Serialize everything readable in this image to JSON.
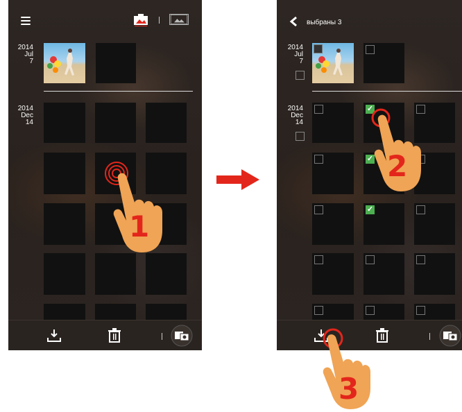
{
  "left_screen": {
    "dates": [
      {
        "year": "2014",
        "month": "Jul",
        "day": "7"
      },
      {
        "year": "2014",
        "month": "Dec",
        "day": "14"
      }
    ],
    "icons": {
      "menu": "menu-icon",
      "camera_tab": "camera-tab-icon",
      "gallery_tab": "gallery-tab-icon",
      "download": "download-icon",
      "delete": "trash-icon",
      "camera_switch": "camera-switch-icon"
    }
  },
  "right_screen": {
    "title": "выбраны 3",
    "dates": [
      {
        "year": "2014",
        "month": "Jul",
        "day": "7"
      },
      {
        "year": "2014",
        "month": "Dec",
        "day": "14"
      }
    ]
  },
  "step_labels": [
    "1",
    "2",
    "3"
  ],
  "colors": {
    "accent_red": "#e3261b",
    "hand": "#f0a455",
    "check_green": "#4caf50"
  }
}
